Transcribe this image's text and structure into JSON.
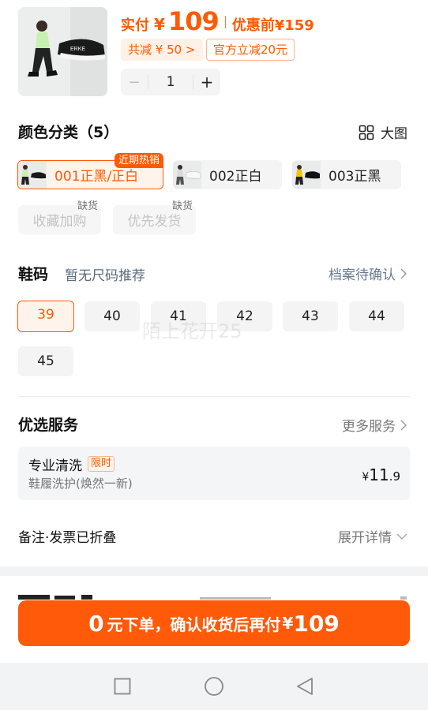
{
  "product": {
    "price_label": "实付",
    "currency": "¥",
    "price": "109",
    "before_label": "优惠前",
    "before_price": "¥159",
    "discount_tag": "共减 ¥ 50 >",
    "official_tag": "官方立减20元",
    "qty_minus": "−",
    "quantity": "1",
    "qty_plus": "+"
  },
  "colors": {
    "title": "颜色分类（5）",
    "big_view": "大图",
    "items": [
      {
        "label": "001正黑/正白",
        "badge": "近期热销",
        "selected": true
      },
      {
        "label": "002正白"
      },
      {
        "label": "003正黑"
      },
      {
        "label": "收藏加购",
        "stock": "缺货"
      },
      {
        "label": "优先发货",
        "stock": "缺货"
      }
    ]
  },
  "sizes": {
    "title": "鞋码",
    "tip": "暂无尺码推荐",
    "archive": "档案待确认",
    "items": [
      "39",
      "40",
      "41",
      "42",
      "43",
      "44",
      "45"
    ],
    "selected": "39"
  },
  "services": {
    "title": "优选服务",
    "more": "更多服务",
    "card": {
      "name": "专业清洗",
      "badge": "限时",
      "desc": "鞋履洗护(焕然一新)",
      "price_yen": "¥",
      "price_int": "11",
      "price_dec": ".9"
    }
  },
  "remark": {
    "label": "备注·发票已折叠",
    "expand": "展开详情"
  },
  "cta": {
    "zero": "0",
    "text": "元下单，确认收货后再付",
    "yen": "¥",
    "amount": "109"
  },
  "watermark": "陌上花开25",
  "colors_theme": {
    "accent": "#ff5a00",
    "chip_bg": "#f4f4f4"
  }
}
